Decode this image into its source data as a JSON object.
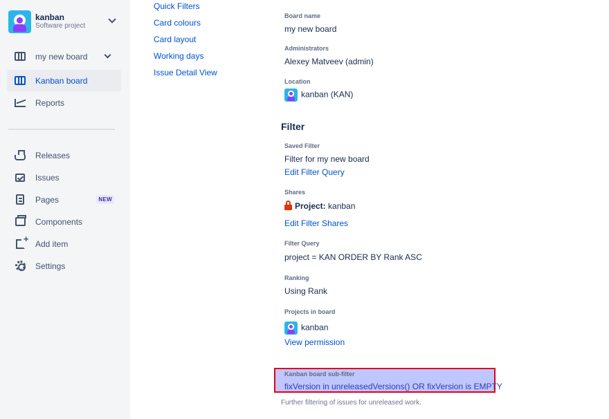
{
  "sidebar": {
    "project": {
      "name": "kanban",
      "type": "Software project"
    },
    "board_selector": "my new board",
    "items": [
      {
        "label": "Kanban board",
        "icon": "board-icon",
        "active": true
      },
      {
        "label": "Reports",
        "icon": "reports-icon"
      },
      {
        "label": "Releases",
        "icon": "releases-icon"
      },
      {
        "label": "Issues",
        "icon": "issues-icon"
      },
      {
        "label": "Pages",
        "icon": "pages-icon",
        "badge": "NEW"
      },
      {
        "label": "Components",
        "icon": "components-icon"
      },
      {
        "label": "Add item",
        "icon": "add-item-icon"
      },
      {
        "label": "Settings",
        "icon": "settings-icon"
      }
    ]
  },
  "settings_menu": [
    "Quick Filters",
    "Card colours",
    "Card layout",
    "Working days",
    "Issue Detail View"
  ],
  "main": {
    "board_name_label": "Board name",
    "board_name": "my new board",
    "administrators_label": "Administrators",
    "administrators": "Alexey Matveev (admin)",
    "location_label": "Location",
    "location": "kanban (KAN)",
    "filter_title": "Filter",
    "saved_filter_label": "Saved Filter",
    "saved_filter": "Filter for my new board",
    "edit_filter_query": "Edit Filter Query",
    "shares_label": "Shares",
    "shares_prefix": "Project:",
    "shares_value": "kanban",
    "edit_filter_shares": "Edit Filter Shares",
    "filter_query_label": "Filter Query",
    "filter_query": "project = KAN ORDER BY Rank ASC",
    "ranking_label": "Ranking",
    "ranking": "Using Rank",
    "projects_label": "Projects in board",
    "project": "kanban",
    "view_permission": "View permission",
    "subfilter_label": "Kanban board sub-filter",
    "subfilter": "fixVersion in unreleasedVersions() OR fixVersion is EMPTY",
    "subfilter_help": "Further filtering of issues for unreleased work."
  },
  "colors": {
    "accent": "#0052cc",
    "highlight": "#c0c6ff",
    "highlight_border": "#e1001a"
  }
}
